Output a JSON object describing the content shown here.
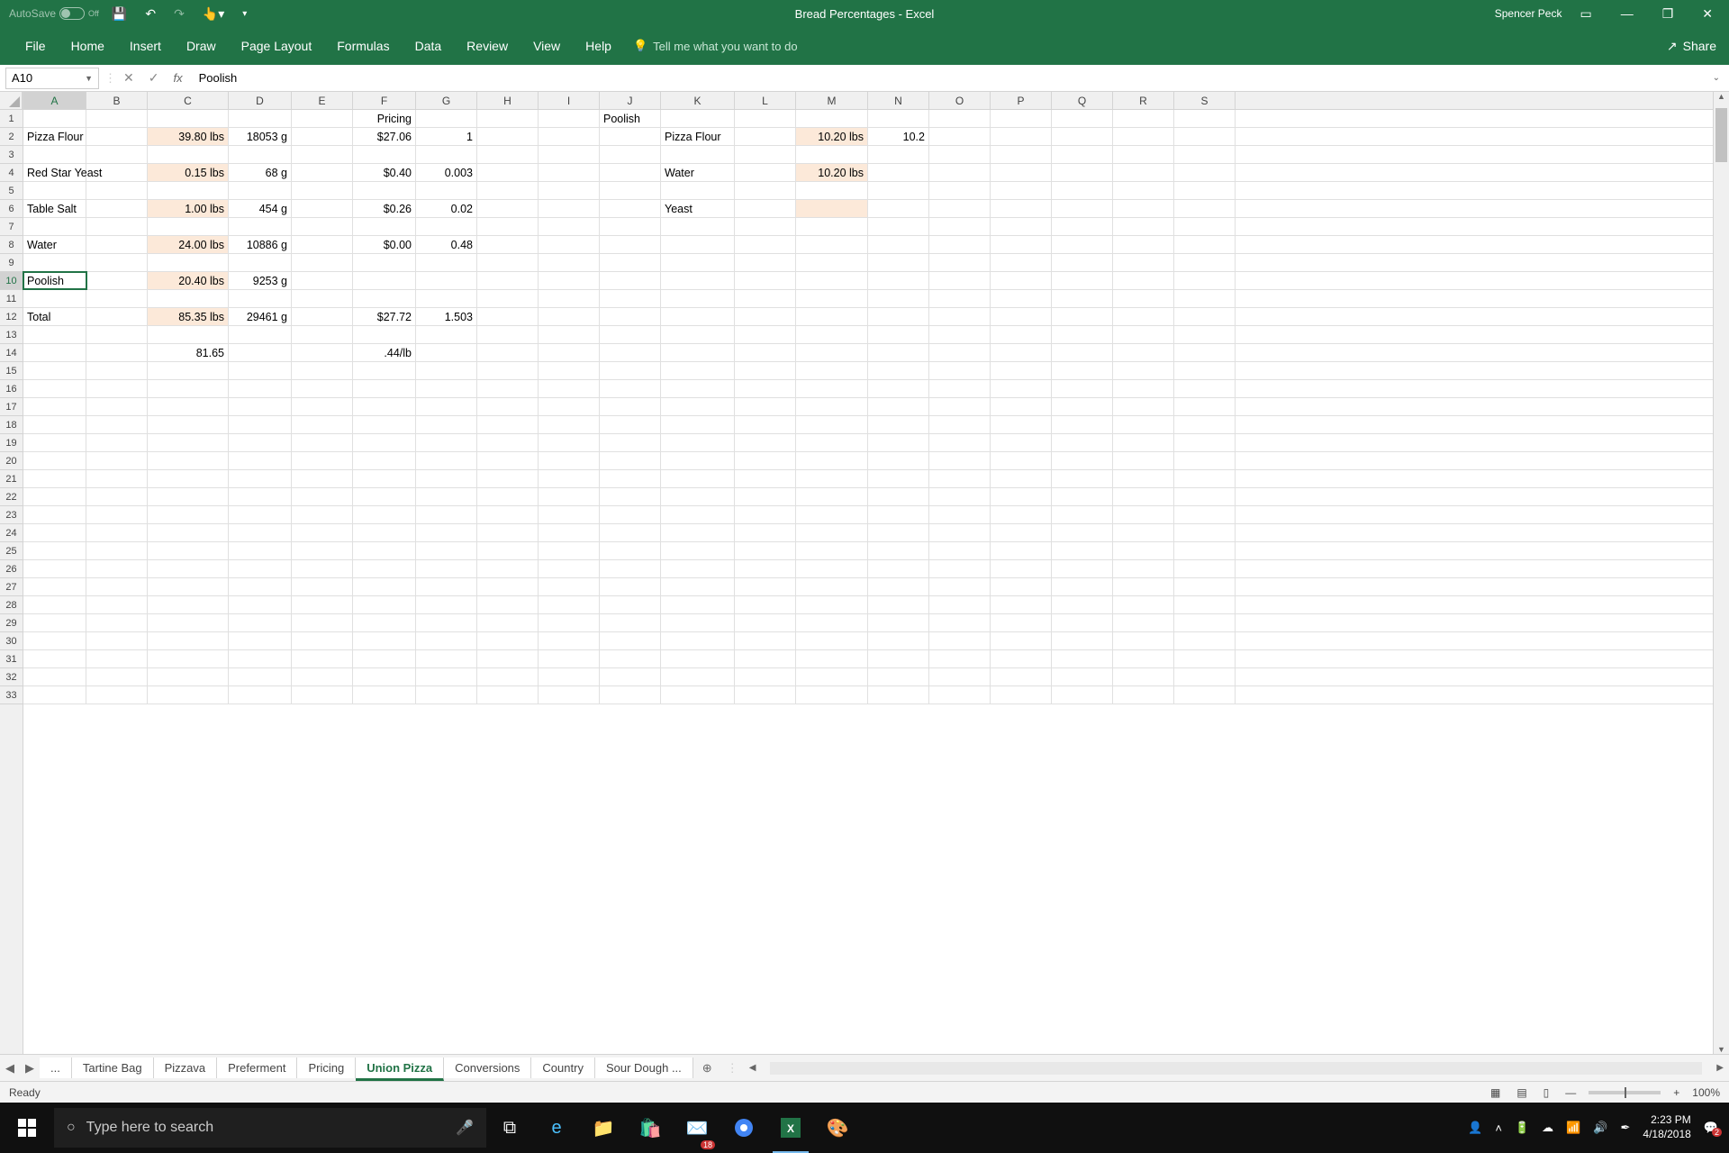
{
  "titlebar": {
    "autosave_label": "AutoSave",
    "autosave_state": "Off",
    "doc_title": "Bread Percentages - Excel",
    "user": "Spencer Peck"
  },
  "ribbon": {
    "tabs": [
      "File",
      "Home",
      "Insert",
      "Draw",
      "Page Layout",
      "Formulas",
      "Data",
      "Review",
      "View",
      "Help"
    ],
    "tellme": "Tell me what you want to do",
    "share": "Share"
  },
  "formula": {
    "namebox": "A10",
    "value": "Poolish"
  },
  "columns": [
    "A",
    "B",
    "C",
    "D",
    "E",
    "F",
    "G",
    "H",
    "I",
    "J",
    "K",
    "L",
    "M",
    "N",
    "O",
    "P",
    "Q",
    "R",
    "S"
  ],
  "rows_count": 33,
  "selected_row": 10,
  "cells": {
    "r1": {
      "F": "Pricing",
      "J": "Poolish"
    },
    "r2": {
      "A": "Pizza Flour",
      "C": "39.80 lbs",
      "D": "18053 g",
      "F": "$27.06",
      "G": "1",
      "K": "Pizza Flour",
      "M": "10.20 lbs",
      "N": "10.2"
    },
    "r4": {
      "A": "Red Star Yeast",
      "C": "0.15 lbs",
      "D": "68 g",
      "F": "$0.40",
      "G": "0.003",
      "K": "Water",
      "M": "10.20 lbs"
    },
    "r6": {
      "A": "Table Salt",
      "C": "1.00 lbs",
      "D": "454 g",
      "F": "$0.26",
      "G": "0.02",
      "K": "Yeast"
    },
    "r8": {
      "A": "Water",
      "C": "24.00 lbs",
      "D": "10886 g",
      "F": "$0.00",
      "G": "0.48"
    },
    "r10": {
      "A": "Poolish",
      "C": "20.40 lbs",
      "D": "9253 g"
    },
    "r12": {
      "A": "Total",
      "C": "85.35 lbs",
      "D": "29461 g",
      "F": "$27.72",
      "G": "1.503"
    },
    "r14": {
      "C": "81.65",
      "F": ".44/lb"
    }
  },
  "highlights": [
    {
      "r": 2,
      "c": "C"
    },
    {
      "r": 2,
      "c": "M"
    },
    {
      "r": 4,
      "c": "C"
    },
    {
      "r": 4,
      "c": "M"
    },
    {
      "r": 6,
      "c": "C"
    },
    {
      "r": 6,
      "c": "M"
    },
    {
      "r": 8,
      "c": "C"
    },
    {
      "r": 10,
      "c": "C"
    },
    {
      "r": 12,
      "c": "C"
    }
  ],
  "sheets": {
    "nav_dots": "...",
    "tabs": [
      "Tartine Bag",
      "Pizzava",
      "Preferment",
      "Pricing",
      "Union Pizza",
      "Conversions",
      "Country",
      "Sour Dough ..."
    ],
    "active": "Union Pizza"
  },
  "status": {
    "ready": "Ready",
    "zoom": "100%"
  },
  "taskbar": {
    "search_placeholder": "Type here to search",
    "badge_mail": "18",
    "time": "2:23 PM",
    "date": "4/18/2018",
    "notif_count": "2"
  }
}
